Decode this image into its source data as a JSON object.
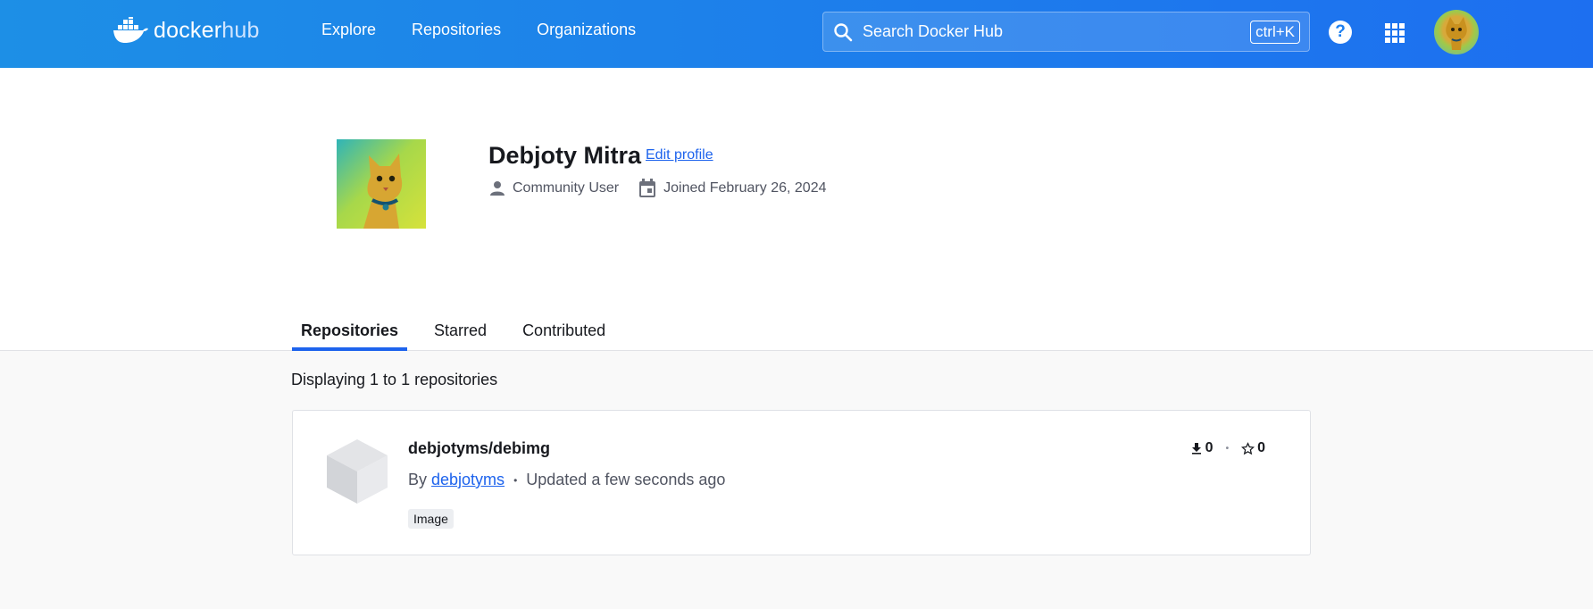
{
  "header": {
    "logo_docker": "docker",
    "logo_hub": "hub",
    "nav": [
      {
        "label": "Explore"
      },
      {
        "label": "Repositories"
      },
      {
        "label": "Organizations"
      }
    ],
    "search": {
      "placeholder": "Search Docker Hub",
      "shortcut": "ctrl+K"
    },
    "help_icon": "help-icon",
    "apps_icon": "apps-grid-icon",
    "avatar": "user-avatar"
  },
  "profile": {
    "name": "Debjoty Mitra",
    "edit_label": "Edit profile",
    "user_type": "Community User",
    "joined": "Joined February 26, 2024"
  },
  "tabs": [
    {
      "label": "Repositories",
      "active": true
    },
    {
      "label": "Starred",
      "active": false
    },
    {
      "label": "Contributed",
      "active": false
    }
  ],
  "content": {
    "display_count": "Displaying 1 to 1 repositories",
    "repos": [
      {
        "name": "debjotyms/debimg",
        "by_prefix": "By",
        "owner": "debjotyms",
        "updated": "Updated a few seconds ago",
        "badge": "Image",
        "downloads": "0",
        "stars": "0"
      }
    ]
  },
  "colors": {
    "header_start": "#1d8fe6",
    "header_end": "#1d6ff0",
    "accent": "#1d63ed"
  }
}
